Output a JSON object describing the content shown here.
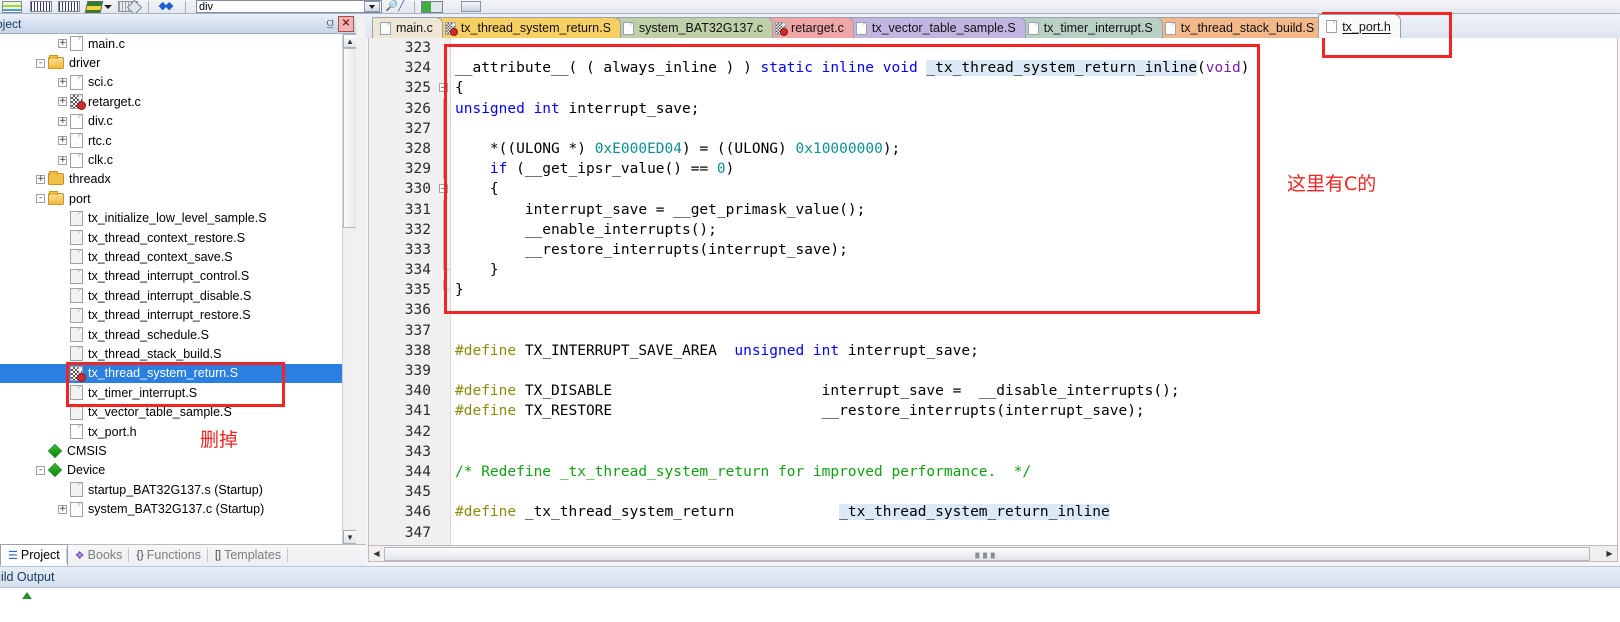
{
  "toolbar": {
    "search_value": "div",
    "search_placeholder": "",
    "icons": [
      "books-icon",
      "grid-icon",
      "grid2-icon",
      "layers-icon",
      "caret-down-icon",
      "erase-icon",
      "blue-arrows-icon",
      "binoculars-icon",
      "green-box-icon",
      "window-icon"
    ]
  },
  "project_panel": {
    "title": "oject",
    "pin_glyph": "⫑",
    "close_glyph": "✕",
    "tree": [
      {
        "label": "main.c",
        "indent": 2,
        "expander": "+",
        "icon": "c-file-icon"
      },
      {
        "label": "driver",
        "indent": 1,
        "expander": "-",
        "icon": "folder-open-icon"
      },
      {
        "label": "sci.c",
        "indent": 2,
        "expander": "+",
        "icon": "c-file-icon"
      },
      {
        "label": "retarget.c",
        "indent": 2,
        "expander": "+",
        "icon": "c-file-modified-icon"
      },
      {
        "label": "div.c",
        "indent": 2,
        "expander": "+",
        "icon": "c-file-icon"
      },
      {
        "label": "rtc.c",
        "indent": 2,
        "expander": "+",
        "icon": "c-file-icon"
      },
      {
        "label": "clk.c",
        "indent": 2,
        "expander": "+",
        "icon": "c-file-icon"
      },
      {
        "label": "threadx",
        "indent": 1,
        "expander": "+",
        "icon": "folder-icon"
      },
      {
        "label": "port",
        "indent": 1,
        "expander": "-",
        "icon": "folder-open-icon"
      },
      {
        "label": "tx_initialize_low_level_sample.S",
        "indent": 2,
        "expander": "",
        "icon": "asm-file-icon"
      },
      {
        "label": "tx_thread_context_restore.S",
        "indent": 2,
        "expander": "",
        "icon": "asm-file-icon"
      },
      {
        "label": "tx_thread_context_save.S",
        "indent": 2,
        "expander": "",
        "icon": "asm-file-icon"
      },
      {
        "label": "tx_thread_interrupt_control.S",
        "indent": 2,
        "expander": "",
        "icon": "asm-file-icon"
      },
      {
        "label": "tx_thread_interrupt_disable.S",
        "indent": 2,
        "expander": "",
        "icon": "asm-file-icon"
      },
      {
        "label": "tx_thread_interrupt_restore.S",
        "indent": 2,
        "expander": "",
        "icon": "asm-file-icon"
      },
      {
        "label": "tx_thread_schedule.S",
        "indent": 2,
        "expander": "",
        "icon": "asm-file-icon"
      },
      {
        "label": "tx_thread_stack_build.S",
        "indent": 2,
        "expander": "",
        "icon": "asm-file-icon"
      },
      {
        "label": "tx_thread_system_return.S",
        "indent": 2,
        "expander": "",
        "icon": "asm-file-modified-icon",
        "selected": true
      },
      {
        "label": "tx_timer_interrupt.S",
        "indent": 2,
        "expander": "",
        "icon": "asm-file-icon"
      },
      {
        "label": "tx_vector_table_sample.S",
        "indent": 2,
        "expander": "",
        "icon": "asm-file-icon"
      },
      {
        "label": "tx_port.h",
        "indent": 2,
        "expander": "",
        "icon": "header-file-icon"
      },
      {
        "label": "CMSIS",
        "indent": 1,
        "expander": "",
        "icon": "component-icon"
      },
      {
        "label": "Device",
        "indent": 1,
        "expander": "-",
        "icon": "component-icon"
      },
      {
        "label": "startup_BAT32G137.s (Startup)",
        "indent": 2,
        "expander": "",
        "icon": "asm-file-icon"
      },
      {
        "label": "system_BAT32G137.c (Startup)",
        "indent": 2,
        "expander": "+",
        "icon": "c-file-icon"
      }
    ],
    "bottom_tabs": [
      {
        "label": "Project",
        "active": true,
        "icon": "project-icon"
      },
      {
        "label": "Books",
        "active": false,
        "icon": "books-icon"
      },
      {
        "label": "Functions",
        "active": false,
        "icon": "braces-icon"
      },
      {
        "label": "Templates",
        "active": false,
        "icon": "templates-icon"
      }
    ]
  },
  "status": {
    "build_output_label": "uild Output"
  },
  "editor": {
    "tabs": [
      {
        "label": "main.c",
        "color": "#efe7d6",
        "icon": "c-file-icon",
        "active": false
      },
      {
        "label": "tx_thread_system_return.S",
        "color": "#f7cf63",
        "icon": "asm-file-modified-icon",
        "active": false
      },
      {
        "label": "system_BAT32G137.c",
        "color": "#bfd0a8",
        "icon": "c-file-icon",
        "active": false
      },
      {
        "label": "retarget.c",
        "color": "#f0a6a6",
        "icon": "c-file-modified-icon",
        "active": false
      },
      {
        "label": "tx_vector_table_sample.S",
        "color": "#c3b5e2",
        "icon": "asm-file-icon",
        "active": false
      },
      {
        "label": "tx_timer_interrupt.S",
        "color": "#b8cfc4",
        "icon": "asm-file-icon",
        "active": false
      },
      {
        "label": "tx_thread_stack_build.S",
        "color": "#f2b88a",
        "icon": "asm-file-icon",
        "active": false
      },
      {
        "label": "tx_port.h",
        "color": "#fbfafb",
        "icon": "header-file-icon",
        "active": true
      }
    ],
    "first_line_number": 323,
    "lines": [
      {
        "n": 323,
        "fold": "",
        "segs": []
      },
      {
        "n": 324,
        "fold": "",
        "segs": [
          {
            "t": "__attribute__( ( always_inline ) ) "
          },
          {
            "t": "static inline void ",
            "c": "kw"
          },
          {
            "t": "_tx_thread_system_return_inline",
            "c": "hl"
          },
          {
            "t": "("
          },
          {
            "t": "void",
            "c": "type"
          },
          {
            "t": ")"
          }
        ]
      },
      {
        "n": 325,
        "fold": "-",
        "segs": [
          {
            "t": "{"
          }
        ]
      },
      {
        "n": 326,
        "fold": "|",
        "segs": [
          {
            "t": "unsigned int",
            "c": "kw"
          },
          {
            "t": " interrupt_save;"
          }
        ]
      },
      {
        "n": 327,
        "fold": "|",
        "segs": []
      },
      {
        "n": 328,
        "fold": "|",
        "segs": [
          {
            "t": "    *((ULONG *) "
          },
          {
            "t": "0xE000ED04",
            "c": "num-lit"
          },
          {
            "t": ") = ((ULONG) "
          },
          {
            "t": "0x10000000",
            "c": "num-lit"
          },
          {
            "t": ");"
          }
        ]
      },
      {
        "n": 329,
        "fold": "|",
        "segs": [
          {
            "t": "    "
          },
          {
            "t": "if",
            "c": "kw"
          },
          {
            "t": " (__get_ipsr_value() == "
          },
          {
            "t": "0",
            "c": "num-lit"
          },
          {
            "t": ")"
          }
        ]
      },
      {
        "n": 330,
        "fold": "-",
        "segs": [
          {
            "t": "    {"
          }
        ]
      },
      {
        "n": 331,
        "fold": "|",
        "segs": [
          {
            "t": "        interrupt_save = __get_primask_value();"
          }
        ]
      },
      {
        "n": 332,
        "fold": "|",
        "segs": [
          {
            "t": "        __enable_interrupts();"
          }
        ]
      },
      {
        "n": 333,
        "fold": "|",
        "segs": [
          {
            "t": "        __restore_interrupts(interrupt_save);"
          }
        ]
      },
      {
        "n": 334,
        "fold": "L",
        "segs": [
          {
            "t": "    }"
          }
        ]
      },
      {
        "n": 335,
        "fold": "L",
        "segs": [
          {
            "t": "}"
          }
        ]
      },
      {
        "n": 336,
        "fold": "",
        "segs": []
      },
      {
        "n": 337,
        "fold": "",
        "segs": []
      },
      {
        "n": 338,
        "fold": "",
        "segs": [
          {
            "t": "#define",
            "c": "prep"
          },
          {
            "t": " TX_INTERRUPT_SAVE_AREA  "
          },
          {
            "t": "unsigned int",
            "c": "kw"
          },
          {
            "t": " interrupt_save;"
          }
        ]
      },
      {
        "n": 339,
        "fold": "",
        "segs": []
      },
      {
        "n": 340,
        "fold": "",
        "segs": [
          {
            "t": "#define",
            "c": "prep"
          },
          {
            "t": " TX_DISABLE                        interrupt_save =  __disable_interrupts();"
          }
        ]
      },
      {
        "n": 341,
        "fold": "",
        "segs": [
          {
            "t": "#define",
            "c": "prep"
          },
          {
            "t": " TX_RESTORE                        __restore_interrupts(interrupt_save);"
          }
        ]
      },
      {
        "n": 342,
        "fold": "",
        "segs": []
      },
      {
        "n": 343,
        "fold": "",
        "segs": []
      },
      {
        "n": 344,
        "fold": "",
        "segs": [
          {
            "t": "/* Redefine _tx_thread_system_return for improved performance.  */",
            "c": "cmt"
          }
        ]
      },
      {
        "n": 345,
        "fold": "",
        "segs": []
      },
      {
        "n": 346,
        "fold": "",
        "segs": [
          {
            "t": "#define",
            "c": "prep"
          },
          {
            "t": " _tx_thread_system_return            "
          },
          {
            "t": "_tx_thread_system_return_inline",
            "c": "hl"
          }
        ]
      },
      {
        "n": 347,
        "fold": "",
        "segs": []
      }
    ]
  },
  "annotations": {
    "note_code": "这里有C的",
    "note_tree": "删掉",
    "accent_color": "#f22424",
    "selection_color": "#2a7fe0",
    "highlight_color": "#dceaf7"
  }
}
